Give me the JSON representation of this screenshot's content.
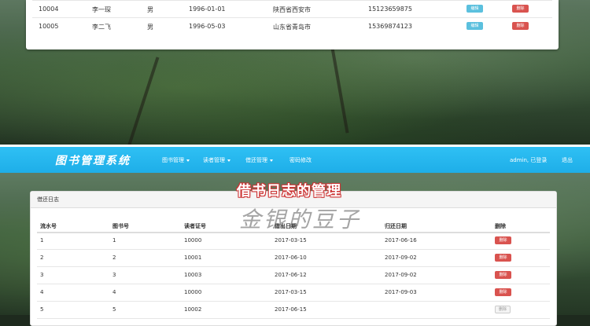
{
  "top_table": {
    "rows": [
      {
        "id": "10004",
        "name": "李一琛",
        "gender": "男",
        "birth": "1996-01-01",
        "address": "陕西省西安市",
        "phone": "15123659875",
        "edit": "编辑",
        "delete": "删除"
      },
      {
        "id": "10005",
        "name": "李二飞",
        "gender": "男",
        "birth": "1996-05-03",
        "address": "山东省青岛市",
        "phone": "15369874123",
        "edit": "编辑",
        "delete": "删除"
      }
    ]
  },
  "navbar": {
    "brand": "图书管理系统",
    "items": [
      "图书管理",
      "读者管理",
      "借还管理",
      "密码修改"
    ],
    "user": "admin, 已登录",
    "logout": "退出"
  },
  "overlay": {
    "title": "借书日志的管理",
    "watermark": "金银的豆子"
  },
  "panel": {
    "heading": "借还日志",
    "columns": [
      "流水号",
      "图书号",
      "读者证号",
      "借出日期",
      "归还日期",
      "删除"
    ],
    "rows": [
      {
        "serial": "1",
        "book": "1",
        "reader": "10000",
        "out": "2017-03-15",
        "back": "2017-06-16",
        "delete": "删除"
      },
      {
        "serial": "2",
        "book": "2",
        "reader": "10001",
        "out": "2017-06-10",
        "back": "2017-09-02",
        "delete": "删除"
      },
      {
        "serial": "3",
        "book": "3",
        "reader": "10003",
        "out": "2017-06-12",
        "back": "2017-09-02",
        "delete": "删除"
      },
      {
        "serial": "4",
        "book": "4",
        "reader": "10000",
        "out": "2017-03-15",
        "back": "2017-09-03",
        "delete": "删除"
      },
      {
        "serial": "5",
        "book": "5",
        "reader": "10002",
        "out": "2017-06-15",
        "back": "",
        "delete": "删除"
      }
    ]
  },
  "colors": {
    "navbar": "#1eaee8",
    "edit": "#5bc0de",
    "delete": "#d9534f"
  }
}
